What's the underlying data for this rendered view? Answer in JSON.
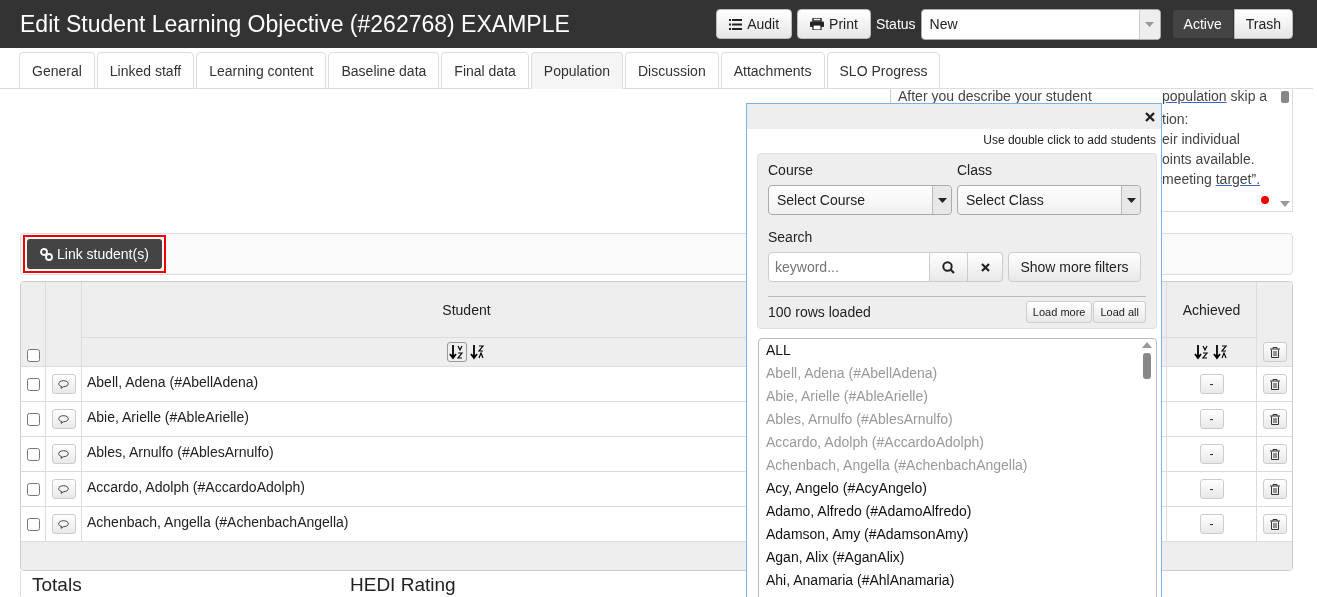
{
  "header": {
    "title": "Edit Student Learning Objective (#262768) EXAMPLE",
    "buttons": [
      {
        "label": "Audit",
        "kind": "list"
      },
      {
        "label": "Print",
        "kind": "print"
      }
    ],
    "status_label": "Status",
    "status_value": "New",
    "toggle": [
      {
        "label": "Active",
        "selected": true
      },
      {
        "label": "Trash",
        "selected": false
      }
    ]
  },
  "tabs": [
    {
      "label": "General",
      "selected": false
    },
    {
      "label": "Linked staff",
      "selected": false
    },
    {
      "label": "Learning content",
      "selected": false
    },
    {
      "label": "Baseline data",
      "selected": false
    },
    {
      "label": "Final data",
      "selected": false
    },
    {
      "label": "Population",
      "selected": true
    },
    {
      "label": "Discussion",
      "selected": false
    },
    {
      "label": "Attachments",
      "selected": false
    },
    {
      "label": "SLO Progress",
      "selected": false
    }
  ],
  "help_panel": {
    "lines": [
      {
        "left": "After you describe your student",
        "parts": [
          {
            "text": "population",
            "link": true
          },
          {
            "text": " skip a",
            "link": false
          }
        ]
      },
      {
        "parts": [
          {
            "text": "tion:",
            "link": false
          }
        ]
      },
      {
        "parts": [
          {
            "text": "eir individual",
            "link": false
          }
        ]
      },
      {
        "parts": [
          {
            "text": "oints available.",
            "link": false
          }
        ]
      },
      {
        "parts": [
          {
            "text": "meeting ",
            "link": false
          },
          {
            "text": "target”.",
            "link": true
          }
        ]
      }
    ]
  },
  "link_button": {
    "label": "Link student(s)"
  },
  "table": {
    "columns": [
      "Student",
      "Achieved"
    ],
    "select_all_checked": false,
    "rows": [
      {
        "student": "Abell, Adena (#AbellAdena)",
        "checked": false,
        "achieved": "-"
      },
      {
        "student": "Abie, Arielle (#AbleArielle)",
        "checked": false,
        "achieved": "-"
      },
      {
        "student": "Ables, Arnulfo (#AblesArnulfo)",
        "checked": false,
        "achieved": "-"
      },
      {
        "student": "Accardo, Adolph (#AccardoAdolph)",
        "checked": false,
        "achieved": "-"
      },
      {
        "student": "Achenbach, Angella (#AchenbachAngella)",
        "checked": false,
        "achieved": "-"
      }
    ]
  },
  "summary": {
    "totals": "Totals",
    "rating": "HEDI Rating"
  },
  "picker": {
    "hint": "Use double click to add students",
    "course_label": "Course",
    "course_value": "Select Course",
    "class_label": "Class",
    "class_value": "Select Class",
    "search_label": "Search",
    "search_placeholder": "keyword...",
    "filters_button": "Show more filters",
    "rows_loaded": "100 rows loaded",
    "load_buttons": [
      "Load more",
      "Load all"
    ],
    "items": [
      {
        "label": "ALL",
        "disabled": false
      },
      {
        "label": "Abell, Adena (#AbellAdena)",
        "disabled": true
      },
      {
        "label": "Abie, Arielle (#AbleArielle)",
        "disabled": true
      },
      {
        "label": "Ables, Arnulfo (#AblesArnulfo)",
        "disabled": true
      },
      {
        "label": "Accardo, Adolph (#AccardoAdolph)",
        "disabled": true
      },
      {
        "label": "Achenbach, Angella (#AchenbachAngella)",
        "disabled": true
      },
      {
        "label": "Acy, Angelo (#AcyAngelo)",
        "disabled": false
      },
      {
        "label": "Adamo, Alfredo (#AdamoAlfredo)",
        "disabled": false
      },
      {
        "label": "Adamson, Amy (#AdamsonAmy)",
        "disabled": false
      },
      {
        "label": "Agan, Alix (#AganAlix)",
        "disabled": false
      },
      {
        "label": "Ahi, Anamaria (#AhlAnamaria)",
        "disabled": false
      }
    ]
  }
}
